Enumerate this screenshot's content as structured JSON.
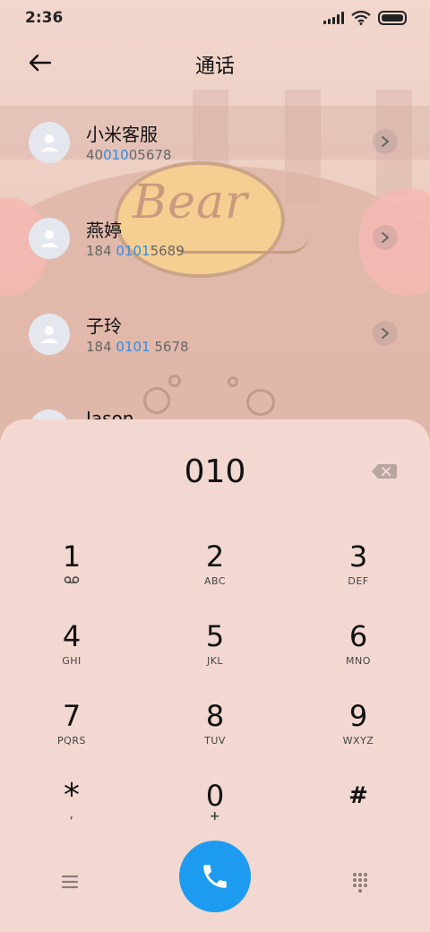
{
  "status_bar": {
    "time": "2:36"
  },
  "header": {
    "title": "通话"
  },
  "wallpaper": {
    "text": "Bear"
  },
  "contacts": [
    {
      "name": "小米客服",
      "number_before": "40",
      "number_match": "010",
      "number_after": "05678"
    },
    {
      "name": "燕婷",
      "number_before": "184 ",
      "number_match": "0101",
      "number_after": "5689"
    },
    {
      "name": "子玲",
      "number_before": "184 ",
      "number_match": "0101",
      "number_after": " 5678"
    },
    {
      "name": "Jason",
      "number_before": "",
      "number_match": "",
      "number_after": ""
    }
  ],
  "dialpad": {
    "input_value": "010",
    "keys": [
      {
        "digit": "1",
        "letters": ""
      },
      {
        "digit": "2",
        "letters": "ABC"
      },
      {
        "digit": "3",
        "letters": "DEF"
      },
      {
        "digit": "4",
        "letters": "GHI"
      },
      {
        "digit": "5",
        "letters": "JKL"
      },
      {
        "digit": "6",
        "letters": "MNO"
      },
      {
        "digit": "7",
        "letters": "PQRS"
      },
      {
        "digit": "8",
        "letters": "TUV"
      },
      {
        "digit": "9",
        "letters": "WXYZ"
      },
      {
        "digit": "*",
        "letters": ","
      },
      {
        "digit": "0",
        "letters": "+"
      },
      {
        "digit": "#",
        "letters": ""
      }
    ]
  },
  "colors": {
    "accent": "#1d9bf0",
    "match_highlight": "#2f8be6"
  },
  "icons": {
    "voicemail": "voicemail-icon",
    "call": "phone-icon",
    "menu": "menu-icon",
    "keypad": "keypad-grid-icon",
    "back": "back-arrow-icon",
    "backspace": "backspace-icon"
  }
}
